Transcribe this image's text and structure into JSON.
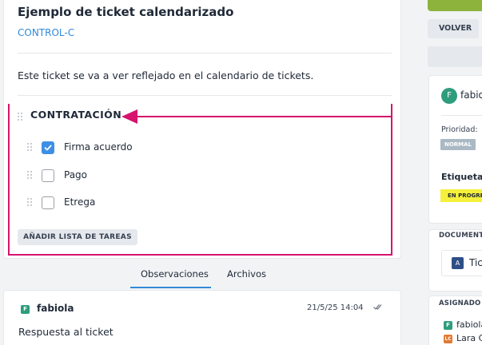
{
  "ticket": {
    "title": "Ejemplo de ticket calendarizado",
    "subtitle": "CONTROL-C",
    "description": "Este ticket se va a ver reflejado en el calendario de tickets."
  },
  "checklist": {
    "title": "CONTRATACIÓN",
    "items": [
      {
        "label": "Firma acuerdo",
        "checked": true
      },
      {
        "label": "Pago",
        "checked": false
      },
      {
        "label": "Etrega",
        "checked": false
      }
    ],
    "add_button": "AÑADIR LISTA DE TAREAS"
  },
  "annotation": {
    "color": "#d6136d"
  },
  "tabs": [
    {
      "label": "Observaciones",
      "active": true
    },
    {
      "label": "Archivos",
      "active": false
    }
  ],
  "comment": {
    "avatar_letter": "F",
    "user": "fabiola",
    "date": "21/5/25 14:04",
    "status_icon": "double-check-icon",
    "text": "Respuesta al ticket"
  },
  "sidebar": {
    "back_button": "VOLVER",
    "owner_avatar": "F",
    "owner_name": "fabiola",
    "priority_label": "Prioridad:",
    "priority_value": "NORMAL",
    "tags_label": "Etiquetas",
    "tag_value": "EN PROGRE",
    "documents_label": "DOCUMENTO",
    "document_icon": "A",
    "document_name": "Tick",
    "assigned_label": "ASIGNADO A",
    "assignees": [
      {
        "avatar": "F",
        "name": "fabiola",
        "color": "#2e9d7c"
      },
      {
        "avatar": "LC",
        "name": "Lara C",
        "color": "#e07a32"
      }
    ]
  }
}
